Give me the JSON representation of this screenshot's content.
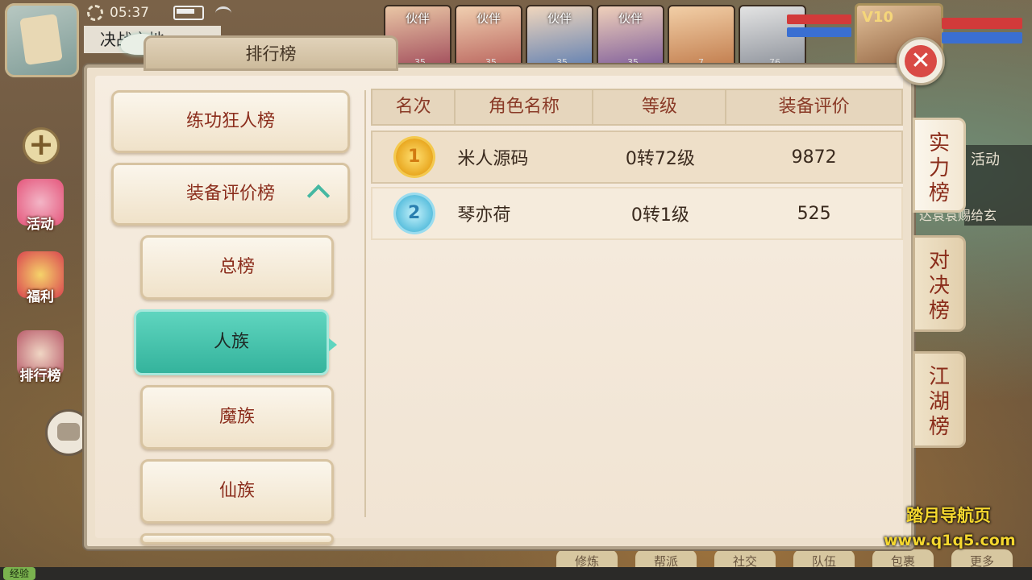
{
  "status_bar": {
    "time": "05:37"
  },
  "hud": {
    "quest_tab": "决战之地",
    "partners": [
      {
        "tag": "伙伴",
        "level": "35",
        "color": "#a04a5a"
      },
      {
        "tag": "伙伴",
        "level": "35",
        "color": "#b7605a"
      },
      {
        "tag": "伙伴",
        "level": "35",
        "color": "#5f7fb2"
      },
      {
        "tag": "伙伴",
        "level": "35",
        "color": "#7b5a9a"
      },
      {
        "tag": "",
        "level": "7",
        "color": "#c07a4a"
      },
      {
        "tag": "",
        "level": "76",
        "color": "#8a8f98"
      }
    ],
    "vip": "V10",
    "side_icons": [
      {
        "label": "活动",
        "color": "#e4547a"
      },
      {
        "label": "福利",
        "color": "#d9434f"
      },
      {
        "label": "排行榜",
        "color": "#b85a6a"
      }
    ],
    "exp_label": "经验",
    "bottom_buttons": [
      "修炼",
      "帮派",
      "社交",
      "队伍",
      "包裹",
      "更多"
    ],
    "right_info": {
      "activity": "活动",
      "notice": "达袁袁赐给玄"
    }
  },
  "watermark": {
    "line1": "踏月导航页",
    "line2": "www.q1q5.com"
  },
  "panel": {
    "title": "排行榜",
    "menu": {
      "top_buttons": [
        "练功狂人榜",
        "装备评价榜"
      ],
      "sub_buttons": [
        "总榜",
        "人族",
        "魔族",
        "仙族"
      ],
      "selected": "人族"
    },
    "table": {
      "headers": [
        "名次",
        "角色名称",
        "等级",
        "装备评价"
      ],
      "rows": [
        {
          "rank": "1",
          "name": "米人源码",
          "level": "0转72级",
          "score": "9872"
        },
        {
          "rank": "2",
          "name": "琴亦荷",
          "level": "0转1级",
          "score": "525"
        }
      ]
    },
    "right_tabs": [
      "实力榜",
      "对决榜",
      "江湖榜"
    ],
    "active_right_tab": "实力榜"
  }
}
